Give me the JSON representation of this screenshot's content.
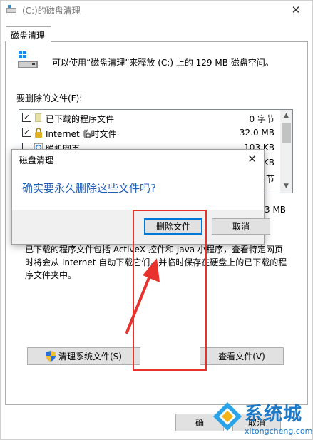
{
  "window": {
    "title": "(C:)的磁盘清理",
    "close_glyph": "✕",
    "tab_label": "磁盘清理"
  },
  "intro": {
    "text": "可以使用“磁盘清理”来释放 (C:) 上的 129 MB 磁盘空间。"
  },
  "file_list": {
    "label": "要删除的文件(F):",
    "items": [
      {
        "name": "已下载的程序文件",
        "size": "0 字节",
        "checked": true,
        "icon": "folder-icon"
      },
      {
        "name": "Internet 临时文件",
        "size": "32.0 MB",
        "checked": true,
        "icon": "lock-icon"
      },
      {
        "name": "脱机网页",
        "size": "103 KB",
        "checked": false,
        "icon": "offline-pages-icon"
      },
      {
        "name": "",
        "size": "KB",
        "checked": false,
        "icon": ""
      },
      {
        "name": "",
        "size": "字节",
        "checked": false,
        "icon": ""
      }
    ],
    "scroll_up": "▲",
    "scroll_down": "▼",
    "check_mark": "✓"
  },
  "total": {
    "text": "3 MB"
  },
  "description": {
    "text": "已下载的程序文件包括 ActiveX 控件和 Java 小程序，查看特定网页时将会从 Internet 自动下载它们，并临时保存在硬盘上的已下载的程序文件夹中。"
  },
  "buttons": {
    "cleanup_system": "清理系统文件(S)",
    "view_files": "查看文件(V)",
    "ok": "确",
    "cancel": "取消"
  },
  "dialog": {
    "title": "磁盘清理",
    "close_glyph": "✕",
    "message": "确实要永久删除这些文件吗?",
    "confirm_label": "删除文件",
    "cancel_label": "取消"
  },
  "watermark": {
    "brand": "系统城",
    "url": "xitongcheng.com"
  },
  "colors": {
    "highlight": "#e8322d",
    "dialog_message": "#1f5eb4",
    "watermark": "#1e7ac7"
  }
}
